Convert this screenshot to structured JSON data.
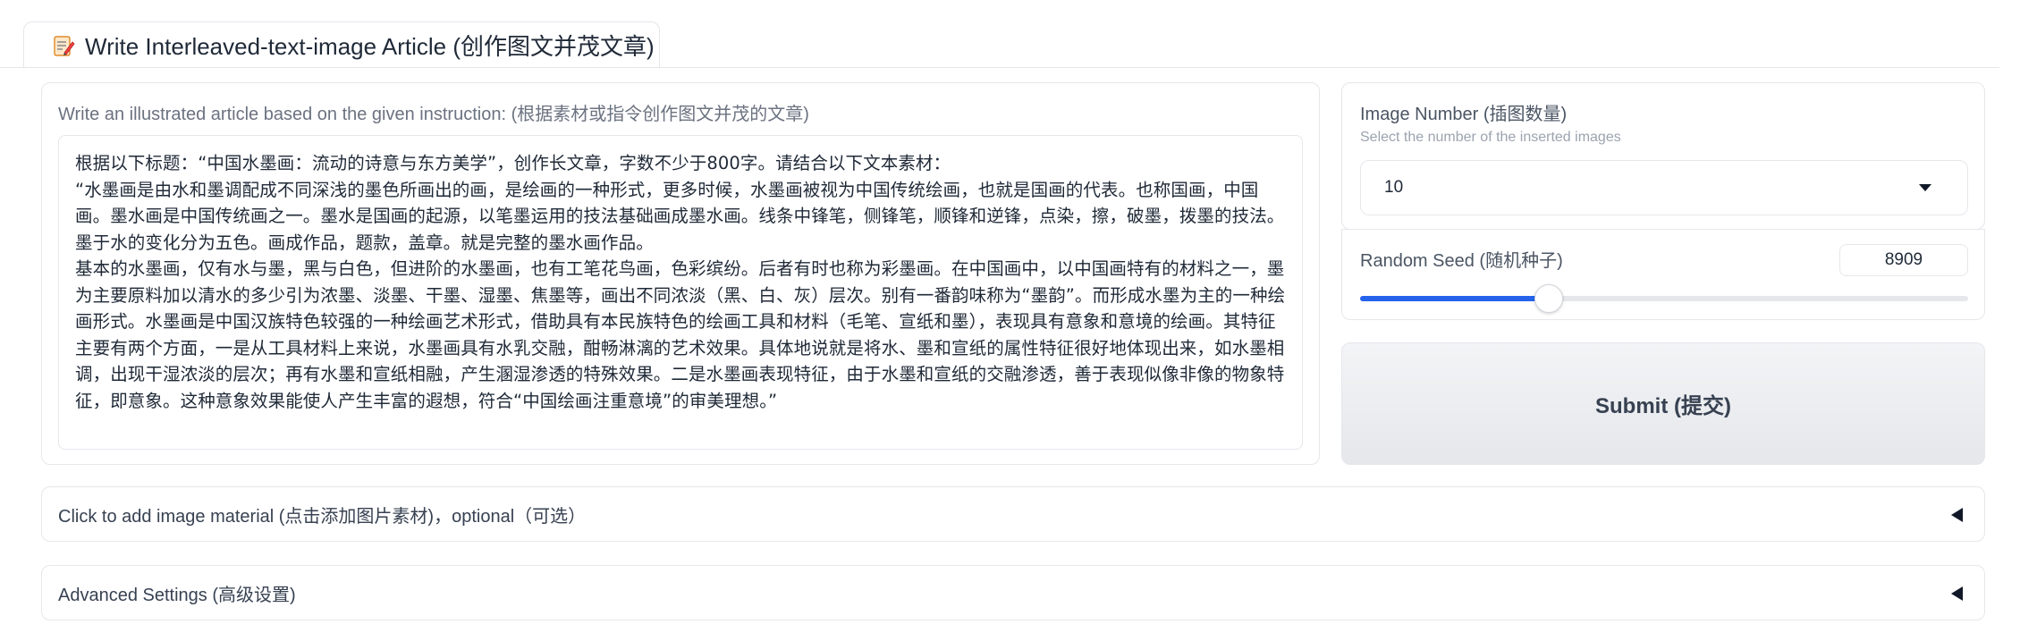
{
  "tab": {
    "icon": "memo-pencil-icon",
    "label": "Write Interleaved-text-image Article (创作图文并茂文章)"
  },
  "instruction": {
    "label": "Write an illustrated article based on the given instruction: (根据素材或指令创作图文并茂的文章)",
    "value": "根据以下标题：“中国水墨画：流动的诗意与东方美学”，创作长文章，字数不少于800字。请结合以下文本素材：\n“水墨画是由水和墨调配成不同深浅的墨色所画出的画，是绘画的一种形式，更多时候，水墨画被视为中国传统绘画，也就是国画的代表。也称国画，中国画。墨水画是中国传统画之一。墨水是国画的起源，以笔墨运用的技法基础画成墨水画。线条中锋笔，侧锋笔，顺锋和逆锋，点染，擦，破墨，拨墨的技法。墨于水的变化分为五色。画成作品，题款，盖章。就是完整的墨水画作品。\n基本的水墨画，仅有水与墨，黑与白色，但进阶的水墨画，也有工笔花鸟画，色彩缤纷。后者有时也称为彩墨画。在中国画中，以中国画特有的材料之一，墨为主要原料加以清水的多少引为浓墨、淡墨、干墨、湿墨、焦墨等，画出不同浓淡（黑、白、灰）层次。别有一番韵味称为“墨韵”。而形成水墨为主的一种绘画形式。水墨画是中国汉族特色较强的一种绘画艺术形式，借助具有本民族特色的绘画工具和材料（毛笔、宣纸和墨），表现具有意象和意境的绘画。其特征主要有两个方面，一是从工具材料上来说，水墨画具有水乳交融，酣畅淋漓的艺术效果。具体地说就是将水、墨和宣纸的属性特征很好地体现出来，如水墨相调，出现干湿浓淡的层次；再有水墨和宣纸相融，产生溷湿渗透的特殊效果。二是水墨画表现特征，由于水墨和宣纸的交融渗透，善于表现似像非像的物象特征，即意象。这种意象效果能使人产生丰富的遐想，符合“中国绘画注重意境”的审美理想。”"
  },
  "image_number": {
    "label": "Image Number (插图数量)",
    "hint": "Select the number of the inserted images",
    "selected": "10"
  },
  "random_seed": {
    "label": "Random Seed (随机种子)",
    "value": "8909",
    "slider_fraction": 0.31
  },
  "submit_label": "Submit (提交)",
  "accordions": [
    {
      "label": "Click to add image material (点击添加图片素材)，optional（可选）"
    },
    {
      "label": "Advanced Settings (高级设置)"
    }
  ],
  "colors": {
    "accent": "#2563eb",
    "border": "#e5e7eb",
    "muted_text": "#6b7280"
  }
}
